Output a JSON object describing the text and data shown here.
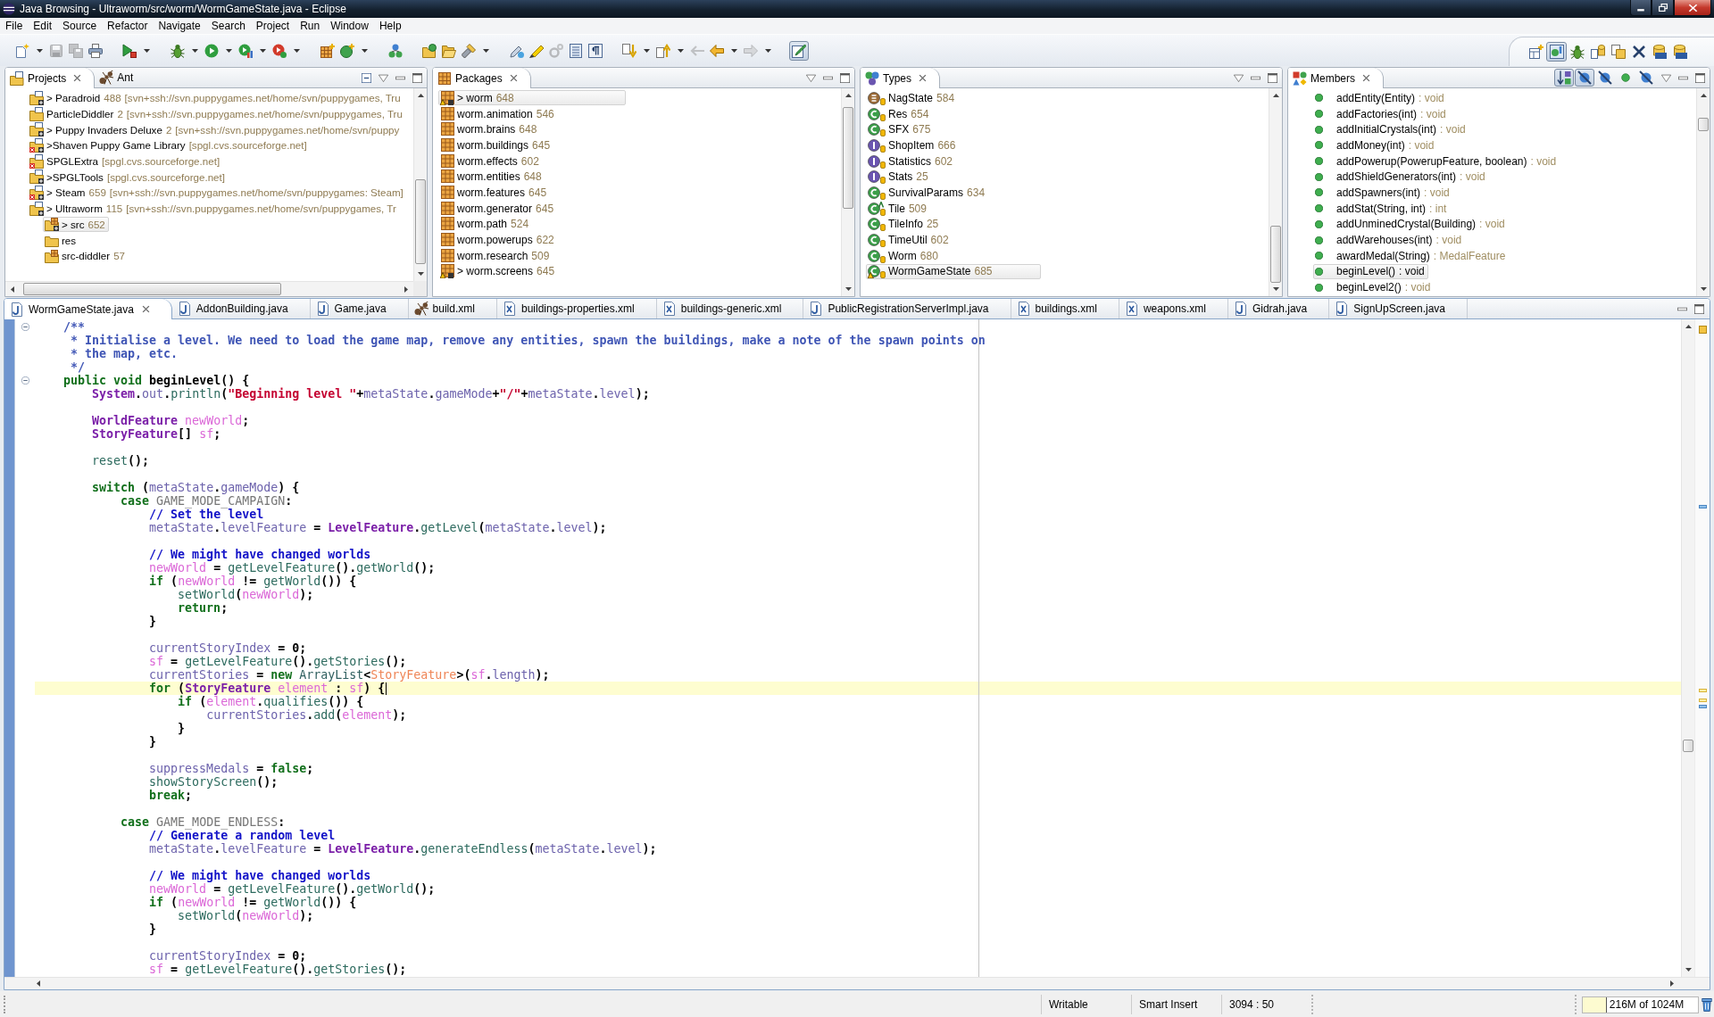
{
  "window": {
    "title": "Java Browsing - Ultraworm/src/worm/WormGameState.java - Eclipse"
  },
  "menu": [
    "File",
    "Edit",
    "Source",
    "Refactor",
    "Navigate",
    "Search",
    "Project",
    "Run",
    "Window",
    "Help"
  ],
  "toolbar": [
    {
      "items": [
        {
          "kind": "new",
          "dropdown": true,
          "disabled": false,
          "pressed": false
        },
        {
          "kind": "save",
          "dropdown": false,
          "disabled": true,
          "pressed": false
        },
        {
          "kind": "save_all",
          "dropdown": false,
          "disabled": true,
          "pressed": false
        },
        {
          "kind": "print",
          "dropdown": false,
          "disabled": false,
          "pressed": false
        }
      ]
    },
    {
      "items": [
        {
          "kind": "external",
          "dropdown": true,
          "disabled": false,
          "pressed": false
        }
      ]
    },
    {
      "items": [
        {
          "kind": "debug",
          "dropdown": true,
          "disabled": false,
          "pressed": false
        },
        {
          "kind": "run",
          "dropdown": true,
          "disabled": false,
          "pressed": false
        },
        {
          "kind": "coverage",
          "dropdown": true,
          "disabled": false,
          "pressed": false
        },
        {
          "kind": "tools",
          "dropdown": true,
          "disabled": false,
          "pressed": false
        }
      ]
    },
    {
      "items": [
        {
          "kind": "new_package",
          "dropdown": false,
          "disabled": false,
          "pressed": false
        },
        {
          "kind": "new_class",
          "dropdown": true,
          "disabled": false,
          "pressed": false
        }
      ]
    },
    {
      "items": [
        {
          "kind": "hierarchy",
          "dropdown": false,
          "disabled": false,
          "pressed": false
        }
      ]
    },
    {
      "items": [
        {
          "kind": "open_type",
          "dropdown": false,
          "disabled": false,
          "pressed": false
        },
        {
          "kind": "open_folder",
          "dropdown": false,
          "disabled": false,
          "pressed": false
        },
        {
          "kind": "search",
          "dropdown": true,
          "disabled": false,
          "pressed": false
        }
      ]
    },
    {
      "items": [
        {
          "kind": "mark",
          "dropdown": false,
          "disabled": false,
          "pressed": false
        },
        {
          "kind": "highlight",
          "dropdown": false,
          "disabled": false,
          "pressed": false
        },
        {
          "kind": "gears",
          "dropdown": false,
          "disabled": true,
          "pressed": false
        },
        {
          "kind": "block",
          "dropdown": false,
          "disabled": false,
          "pressed": false
        },
        {
          "kind": "whitespace",
          "dropdown": false,
          "disabled": false,
          "pressed": false
        }
      ]
    },
    {
      "items": [
        {
          "kind": "next",
          "dropdown": true,
          "disabled": false,
          "pressed": false
        },
        {
          "kind": "previous",
          "dropdown": true,
          "disabled": false,
          "pressed": false
        },
        {
          "kind": "last_edit",
          "dropdown": false,
          "disabled": true,
          "pressed": false
        },
        {
          "kind": "back",
          "dropdown": true,
          "disabled": false,
          "pressed": false
        },
        {
          "kind": "forward",
          "dropdown": true,
          "disabled": true,
          "pressed": false
        }
      ]
    },
    {
      "items": [
        {
          "kind": "breadcrumb",
          "dropdown": false,
          "disabled": false,
          "pressed": true
        }
      ]
    }
  ],
  "perspectives": [
    {
      "kind": "open",
      "selected": false
    },
    {
      "kind": "browsing",
      "selected": true
    },
    {
      "kind": "debug",
      "selected": false
    },
    {
      "kind": "sync",
      "selected": false
    },
    {
      "kind": "java",
      "selected": false
    },
    {
      "kind": "xml",
      "selected": false
    },
    {
      "kind": "svn",
      "selected": false
    },
    {
      "kind": "cvs",
      "selected": false
    }
  ],
  "projects_view": {
    "tabs": [
      {
        "kind": "projects",
        "label": "Projects",
        "selected": true
      },
      {
        "kind": "ant",
        "label": "Ant",
        "selected": false
      }
    ],
    "rows": [
      {
        "kind": "project",
        "label": "> Paradroid",
        "revision": "488",
        "repository": "[svn+ssh://svn.puppygames.net/home/svn/puppygames, Tru",
        "changed": true,
        "errors": false,
        "selected": false
      },
      {
        "kind": "project",
        "label": "ParticleDiddler",
        "revision": "2",
        "repository": "[svn+ssh://svn.puppygames.net/home/svn/puppygames, Tru",
        "changed": false,
        "errors": false,
        "selected": false
      },
      {
        "kind": "project",
        "label": "> Puppy Invaders Deluxe",
        "revision": "2",
        "repository": "[svn+ssh://svn.puppygames.net/home/svn/puppy",
        "changed": true,
        "errors": false,
        "selected": false
      },
      {
        "kind": "project",
        "label": ">Shaven Puppy Game Library",
        "repository": "[spgl.cvs.sourceforge.net]",
        "changed": true,
        "errors": true,
        "selected": false
      },
      {
        "kind": "project",
        "label": "SPGLExtra",
        "repository": "[spgl.cvs.sourceforge.net]",
        "changed": false,
        "errors": true,
        "selected": false
      },
      {
        "kind": "project",
        "label": ">SPGLTools",
        "repository": "[spgl.cvs.sourceforge.net]",
        "changed": true,
        "errors": false,
        "selected": false
      },
      {
        "kind": "project",
        "label": "> Steam",
        "revision": "659",
        "repository": "[svn+ssh://svn.puppygames.net/home/svn/puppygames: Steam]",
        "changed": true,
        "errors": true,
        "selected": false
      },
      {
        "kind": "project",
        "label": "> Ultraworm",
        "revision": "115",
        "repository": "[svn+ssh://svn.puppygames.net/home/svn/puppygames, Tr",
        "changed": true,
        "errors": false,
        "selected": false,
        "children": [
          {
            "kind": "source",
            "label": "> src",
            "revision": "652",
            "changed": true,
            "errors": false,
            "selected": true
          },
          {
            "kind": "folder",
            "label": "res",
            "changed": false,
            "errors": false,
            "selected": false
          },
          {
            "kind": "source",
            "label": "src-diddler",
            "revision": "57",
            "changed": false,
            "errors": false,
            "selected": false
          }
        ]
      }
    ]
  },
  "packages_view": {
    "tabs": [
      {
        "kind": "packages",
        "label": "Packages",
        "selected": true
      }
    ],
    "rows": [
      {
        "label": "> worm",
        "count": "648",
        "changed": true,
        "selected": true
      },
      {
        "label": "worm.animation",
        "count": "546",
        "changed": false,
        "selected": false
      },
      {
        "label": "worm.brains",
        "count": "648",
        "changed": false,
        "selected": false
      },
      {
        "label": "worm.buildings",
        "count": "645",
        "changed": false,
        "selected": false
      },
      {
        "label": "worm.effects",
        "count": "602",
        "changed": false,
        "selected": false
      },
      {
        "label": "worm.entities",
        "count": "648",
        "changed": false,
        "selected": false
      },
      {
        "label": "worm.features",
        "count": "645",
        "changed": false,
        "selected": false
      },
      {
        "label": "worm.generator",
        "count": "645",
        "changed": false,
        "selected": false
      },
      {
        "label": "worm.path",
        "count": "524",
        "changed": false,
        "selected": false
      },
      {
        "label": "worm.powerups",
        "count": "622",
        "changed": false,
        "selected": false
      },
      {
        "label": "worm.research",
        "count": "509",
        "changed": false,
        "selected": false
      },
      {
        "label": "> worm.screens",
        "count": "645",
        "changed": true,
        "selected": false
      }
    ]
  },
  "types_view": {
    "tabs": [
      {
        "kind": "types",
        "label": "Types",
        "selected": true
      }
    ],
    "rows": [
      {
        "kind": "enum",
        "label": "NagState",
        "count": "584",
        "abstract": false,
        "changed": false,
        "selected": false
      },
      {
        "kind": "class",
        "label": "Res",
        "count": "654",
        "abstract": false,
        "changed": false,
        "selected": false
      },
      {
        "kind": "class",
        "label": "SFX",
        "count": "675",
        "abstract": false,
        "changed": false,
        "selected": false
      },
      {
        "kind": "interface",
        "label": "ShopItem",
        "count": "666",
        "abstract": false,
        "changed": false,
        "selected": false
      },
      {
        "kind": "interface",
        "label": "Statistics",
        "count": "602",
        "abstract": false,
        "changed": false,
        "selected": false
      },
      {
        "kind": "interface",
        "label": "Stats",
        "count": "25",
        "abstract": false,
        "changed": false,
        "selected": false
      },
      {
        "kind": "class",
        "label": "SurvivalParams",
        "count": "634",
        "abstract": false,
        "changed": false,
        "selected": false
      },
      {
        "kind": "class",
        "label": "Tile",
        "count": "509",
        "abstract": true,
        "changed": false,
        "selected": false
      },
      {
        "kind": "class",
        "label": "TileInfo",
        "count": "25",
        "abstract": false,
        "changed": false,
        "selected": false
      },
      {
        "kind": "class",
        "label": "TimeUtil",
        "count": "602",
        "abstract": false,
        "changed": false,
        "selected": false
      },
      {
        "kind": "class",
        "label": "Worm",
        "count": "680",
        "abstract": false,
        "changed": false,
        "selected": false
      },
      {
        "kind": "class",
        "label": "WormGameState",
        "count": "685",
        "abstract": false,
        "changed": true,
        "selected": true
      }
    ]
  },
  "members_view": {
    "tabs": [
      {
        "kind": "members",
        "label": "Members",
        "selected": true
      }
    ],
    "toolbar": [
      {
        "kind": "sort",
        "pressed": true
      },
      {
        "kind": "fields",
        "pressed": true
      },
      {
        "kind": "static",
        "pressed": false
      },
      {
        "kind": "public",
        "pressed": false
      },
      {
        "kind": "local",
        "pressed": false
      }
    ],
    "rows": [
      {
        "signature": "addEntity(Entity)",
        "return_type": ": void",
        "selected": false
      },
      {
        "signature": "addFactories(int)",
        "return_type": ": void",
        "selected": false
      },
      {
        "signature": "addInitialCrystals(int)",
        "return_type": ": void",
        "selected": false
      },
      {
        "signature": "addMoney(int)",
        "return_type": ": void",
        "selected": false
      },
      {
        "signature": "addPowerup(PowerupFeature, boolean)",
        "return_type": ": void",
        "selected": false
      },
      {
        "signature": "addShieldGenerators(int)",
        "return_type": ": void",
        "selected": false
      },
      {
        "signature": "addSpawners(int)",
        "return_type": ": void",
        "selected": false
      },
      {
        "signature": "addStat(String, int)",
        "return_type": ": int",
        "selected": false
      },
      {
        "signature": "addUnminedCrystal(Building)",
        "return_type": ": void",
        "selected": false
      },
      {
        "signature": "addWarehouses(int)",
        "return_type": ": void",
        "selected": false
      },
      {
        "signature": "awardMedal(String)",
        "return_type": ": MedalFeature",
        "selected": false
      },
      {
        "signature": "beginLevel()",
        "return_type": ": void",
        "selected": true
      },
      {
        "signature": "beginLevel2()",
        "return_type": ": void",
        "selected": false
      }
    ]
  },
  "editor": {
    "tabs": [
      {
        "kind": "java",
        "label": "WormGameState.java",
        "selected": true
      },
      {
        "kind": "java",
        "label": "AddonBuilding.java",
        "selected": false
      },
      {
        "kind": "java",
        "label": "Game.java",
        "selected": false
      },
      {
        "kind": "ant",
        "label": "build.xml",
        "selected": false
      },
      {
        "kind": "xml",
        "label": "buildings-properties.xml",
        "selected": false
      },
      {
        "kind": "xml",
        "label": "buildings-generic.xml",
        "selected": false
      },
      {
        "kind": "java",
        "label": "PublicRegistrationServerImpl.java",
        "selected": false
      },
      {
        "kind": "xml",
        "label": "buildings.xml",
        "selected": false
      },
      {
        "kind": "xml",
        "label": "weapons.xml",
        "selected": false
      },
      {
        "kind": "java",
        "label": "Gidrah.java",
        "selected": false
      },
      {
        "kind": "java",
        "label": "SignUpScreen.java",
        "selected": false
      }
    ],
    "lines": [
      {
        "current": false,
        "fold": true,
        "tokens": [
          {
            "kind": "jdoc",
            "text": "    /**"
          }
        ]
      },
      {
        "current": false,
        "fold": false,
        "tokens": [
          {
            "kind": "jdoc",
            "text": "     * Initialise a level. We need to load the game map, remove any entities, spawn the buildings, make a note of the spawn points on"
          }
        ]
      },
      {
        "current": false,
        "fold": false,
        "tokens": [
          {
            "kind": "jdoc",
            "text": "     * the map, etc."
          }
        ]
      },
      {
        "current": false,
        "fold": false,
        "tokens": [
          {
            "kind": "jdoc",
            "text": "     */"
          }
        ]
      },
      {
        "current": false,
        "fold": true,
        "tokens": [
          {
            "kind": "kw",
            "text": "    public void "
          },
          {
            "kind": "decl",
            "text": "beginLevel"
          },
          {
            "kind": "op",
            "text": "() {"
          }
        ]
      },
      {
        "current": false,
        "fold": false,
        "tokens": [
          {
            "kind": "type",
            "text": "        System"
          },
          {
            "kind": "op",
            "text": "."
          },
          {
            "kind": "field",
            "text": "out"
          },
          {
            "kind": "op",
            "text": "."
          },
          {
            "kind": "method",
            "text": "println"
          },
          {
            "kind": "op",
            "text": "("
          },
          {
            "kind": "str",
            "text": "\"Beginning level \""
          },
          {
            "kind": "op",
            "text": "+"
          },
          {
            "kind": "field",
            "text": "metaState"
          },
          {
            "kind": "op",
            "text": "."
          },
          {
            "kind": "field",
            "text": "gameMode"
          },
          {
            "kind": "op",
            "text": "+"
          },
          {
            "kind": "str",
            "text": "\"/\""
          },
          {
            "kind": "op",
            "text": "+"
          },
          {
            "kind": "field",
            "text": "metaState"
          },
          {
            "kind": "op",
            "text": "."
          },
          {
            "kind": "field",
            "text": "level"
          },
          {
            "kind": "op",
            "text": ");"
          }
        ]
      },
      {
        "current": false,
        "fold": false
      },
      {
        "current": false,
        "fold": false,
        "tokens": [
          {
            "kind": "type",
            "text": "        WorldFeature "
          },
          {
            "kind": "local",
            "text": "newWorld"
          },
          {
            "kind": "op",
            "text": ";"
          }
        ]
      },
      {
        "current": false,
        "fold": false,
        "tokens": [
          {
            "kind": "type",
            "text": "        StoryFeature"
          },
          {
            "kind": "op",
            "text": "[] "
          },
          {
            "kind": "local",
            "text": "sf"
          },
          {
            "kind": "op",
            "text": ";"
          }
        ]
      },
      {
        "current": false,
        "fold": false
      },
      {
        "current": false,
        "fold": false,
        "tokens": [
          {
            "kind": "method",
            "text": "        reset"
          },
          {
            "kind": "op",
            "text": "();"
          }
        ]
      },
      {
        "current": false,
        "fold": false
      },
      {
        "current": false,
        "fold": false,
        "tokens": [
          {
            "kind": "kw",
            "text": "        switch "
          },
          {
            "kind": "op",
            "text": "("
          },
          {
            "kind": "field",
            "text": "metaState"
          },
          {
            "kind": "op",
            "text": "."
          },
          {
            "kind": "field",
            "text": "gameMode"
          },
          {
            "kind": "op",
            "text": ") {"
          }
        ]
      },
      {
        "current": false,
        "fold": false,
        "tokens": [
          {
            "kind": "kw",
            "text": "            case "
          },
          {
            "kind": "static",
            "text": "GAME_MODE_CAMPAIGN"
          },
          {
            "kind": "op",
            "text": ":"
          }
        ]
      },
      {
        "current": false,
        "fold": false,
        "tokens": [
          {
            "kind": "cmt",
            "text": "                // Set the level"
          }
        ]
      },
      {
        "current": false,
        "fold": false,
        "tokens": [
          {
            "kind": "field",
            "text": "                metaState"
          },
          {
            "kind": "op",
            "text": "."
          },
          {
            "kind": "field",
            "text": "levelFeature"
          },
          {
            "kind": "op",
            "text": " = "
          },
          {
            "kind": "type",
            "text": "LevelFeature"
          },
          {
            "kind": "op",
            "text": "."
          },
          {
            "kind": "method",
            "text": "getLevel"
          },
          {
            "kind": "op",
            "text": "("
          },
          {
            "kind": "field",
            "text": "metaState"
          },
          {
            "kind": "op",
            "text": "."
          },
          {
            "kind": "field",
            "text": "level"
          },
          {
            "kind": "op",
            "text": ");"
          }
        ]
      },
      {
        "current": false,
        "fold": false
      },
      {
        "current": false,
        "fold": false,
        "tokens": [
          {
            "kind": "cmt",
            "text": "                // We might have changed worlds"
          }
        ]
      },
      {
        "current": false,
        "fold": false,
        "tokens": [
          {
            "kind": "local",
            "text": "                newWorld"
          },
          {
            "kind": "op",
            "text": " = "
          },
          {
            "kind": "method",
            "text": "getLevelFeature"
          },
          {
            "kind": "op",
            "text": "()."
          },
          {
            "kind": "method",
            "text": "getWorld"
          },
          {
            "kind": "op",
            "text": "();"
          }
        ]
      },
      {
        "current": false,
        "fold": false,
        "tokens": [
          {
            "kind": "kw",
            "text": "                if "
          },
          {
            "kind": "op",
            "text": "("
          },
          {
            "kind": "local",
            "text": "newWorld"
          },
          {
            "kind": "op",
            "text": " != "
          },
          {
            "kind": "method",
            "text": "getWorld"
          },
          {
            "kind": "op",
            "text": "()) {"
          }
        ]
      },
      {
        "current": false,
        "fold": false,
        "tokens": [
          {
            "kind": "method",
            "text": "                    setWorld"
          },
          {
            "kind": "op",
            "text": "("
          },
          {
            "kind": "local",
            "text": "newWorld"
          },
          {
            "kind": "op",
            "text": ");"
          }
        ]
      },
      {
        "current": false,
        "fold": false,
        "tokens": [
          {
            "kind": "kw",
            "text": "                    return"
          },
          {
            "kind": "op",
            "text": ";"
          }
        ]
      },
      {
        "current": false,
        "fold": false,
        "tokens": [
          {
            "kind": "op",
            "text": "                }"
          }
        ]
      },
      {
        "current": false,
        "fold": false
      },
      {
        "current": false,
        "fold": false,
        "tokens": [
          {
            "kind": "field",
            "text": "                currentStoryIndex"
          },
          {
            "kind": "op",
            "text": " = "
          },
          {
            "kind": "num",
            "text": "0"
          },
          {
            "kind": "op",
            "text": ";"
          }
        ]
      },
      {
        "current": false,
        "fold": false,
        "tokens": [
          {
            "kind": "local",
            "text": "                sf"
          },
          {
            "kind": "op",
            "text": " = "
          },
          {
            "kind": "method",
            "text": "getLevelFeature"
          },
          {
            "kind": "op",
            "text": "()."
          },
          {
            "kind": "method",
            "text": "getStories"
          },
          {
            "kind": "op",
            "text": "();"
          }
        ]
      },
      {
        "current": false,
        "fold": false,
        "tokens": [
          {
            "kind": "field",
            "text": "                currentStories"
          },
          {
            "kind": "op",
            "text": " = "
          },
          {
            "kind": "kw",
            "text": "new "
          },
          {
            "kind": "generic",
            "text": "ArrayList"
          },
          {
            "kind": "op",
            "text": "<"
          },
          {
            "kind": "typearg",
            "text": "StoryFeature"
          },
          {
            "kind": "op",
            "text": ">("
          },
          {
            "kind": "local",
            "text": "sf"
          },
          {
            "kind": "op",
            "text": "."
          },
          {
            "kind": "field",
            "text": "length"
          },
          {
            "kind": "op",
            "text": ");"
          }
        ]
      },
      {
        "current": true,
        "fold": false,
        "tokens": [
          {
            "kind": "kw",
            "text": "                for "
          },
          {
            "kind": "op",
            "text": "("
          },
          {
            "kind": "type",
            "text": "StoryFeature "
          },
          {
            "kind": "local",
            "text": "element"
          },
          {
            "kind": "op",
            "text": " : "
          },
          {
            "kind": "local",
            "text": "sf"
          },
          {
            "kind": "op",
            "text": ") {"
          }
        ]
      },
      {
        "current": false,
        "fold": false,
        "tokens": [
          {
            "kind": "kw",
            "text": "                    if "
          },
          {
            "kind": "op",
            "text": "("
          },
          {
            "kind": "local",
            "text": "element"
          },
          {
            "kind": "op",
            "text": "."
          },
          {
            "kind": "method",
            "text": "qualifies"
          },
          {
            "kind": "op",
            "text": "()) {"
          }
        ]
      },
      {
        "current": false,
        "fold": false,
        "tokens": [
          {
            "kind": "field",
            "text": "                        currentStories"
          },
          {
            "kind": "op",
            "text": "."
          },
          {
            "kind": "method",
            "text": "add"
          },
          {
            "kind": "op",
            "text": "("
          },
          {
            "kind": "local",
            "text": "element"
          },
          {
            "kind": "op",
            "text": ");"
          }
        ]
      },
      {
        "current": false,
        "fold": false,
        "tokens": [
          {
            "kind": "op",
            "text": "                    }"
          }
        ]
      },
      {
        "current": false,
        "fold": false,
        "tokens": [
          {
            "kind": "op",
            "text": "                }"
          }
        ]
      },
      {
        "current": false,
        "fold": false
      },
      {
        "current": false,
        "fold": false,
        "tokens": [
          {
            "kind": "field",
            "text": "                suppressMedals"
          },
          {
            "kind": "op",
            "text": " = "
          },
          {
            "kind": "kw",
            "text": "false"
          },
          {
            "kind": "op",
            "text": ";"
          }
        ]
      },
      {
        "current": false,
        "fold": false,
        "tokens": [
          {
            "kind": "method",
            "text": "                showStoryScreen"
          },
          {
            "kind": "op",
            "text": "();"
          }
        ]
      },
      {
        "current": false,
        "fold": false,
        "tokens": [
          {
            "kind": "kw",
            "text": "                break"
          },
          {
            "kind": "op",
            "text": ";"
          }
        ]
      },
      {
        "current": false,
        "fold": false
      },
      {
        "current": false,
        "fold": false,
        "tokens": [
          {
            "kind": "kw",
            "text": "            case "
          },
          {
            "kind": "static",
            "text": "GAME_MODE_ENDLESS"
          },
          {
            "kind": "op",
            "text": ":"
          }
        ]
      },
      {
        "current": false,
        "fold": false,
        "tokens": [
          {
            "kind": "cmt",
            "text": "                // Generate a random level"
          }
        ]
      },
      {
        "current": false,
        "fold": false,
        "tokens": [
          {
            "kind": "field",
            "text": "                metaState"
          },
          {
            "kind": "op",
            "text": "."
          },
          {
            "kind": "field",
            "text": "levelFeature"
          },
          {
            "kind": "op",
            "text": " = "
          },
          {
            "kind": "type",
            "text": "LevelFeature"
          },
          {
            "kind": "op",
            "text": "."
          },
          {
            "kind": "method",
            "text": "generateEndless"
          },
          {
            "kind": "op",
            "text": "("
          },
          {
            "kind": "field",
            "text": "metaState"
          },
          {
            "kind": "op",
            "text": "."
          },
          {
            "kind": "field",
            "text": "level"
          },
          {
            "kind": "op",
            "text": ");"
          }
        ]
      },
      {
        "current": false,
        "fold": false
      },
      {
        "current": false,
        "fold": false,
        "tokens": [
          {
            "kind": "cmt",
            "text": "                // We might have changed worlds"
          }
        ]
      },
      {
        "current": false,
        "fold": false,
        "tokens": [
          {
            "kind": "local",
            "text": "                newWorld"
          },
          {
            "kind": "op",
            "text": " = "
          },
          {
            "kind": "method",
            "text": "getLevelFeature"
          },
          {
            "kind": "op",
            "text": "()."
          },
          {
            "kind": "method",
            "text": "getWorld"
          },
          {
            "kind": "op",
            "text": "();"
          }
        ]
      },
      {
        "current": false,
        "fold": false,
        "tokens": [
          {
            "kind": "kw",
            "text": "                if "
          },
          {
            "kind": "op",
            "text": "("
          },
          {
            "kind": "local",
            "text": "newWorld"
          },
          {
            "kind": "op",
            "text": " != "
          },
          {
            "kind": "method",
            "text": "getWorld"
          },
          {
            "kind": "op",
            "text": "()) {"
          }
        ]
      },
      {
        "current": false,
        "fold": false,
        "tokens": [
          {
            "kind": "method",
            "text": "                    setWorld"
          },
          {
            "kind": "op",
            "text": "("
          },
          {
            "kind": "local",
            "text": "newWorld"
          },
          {
            "kind": "op",
            "text": ");"
          }
        ]
      },
      {
        "current": false,
        "fold": false,
        "tokens": [
          {
            "kind": "op",
            "text": "                }"
          }
        ]
      },
      {
        "current": false,
        "fold": false
      },
      {
        "current": false,
        "fold": false,
        "tokens": [
          {
            "kind": "field",
            "text": "                currentStoryIndex"
          },
          {
            "kind": "op",
            "text": " = "
          },
          {
            "kind": "num",
            "text": "0"
          },
          {
            "kind": "op",
            "text": ";"
          }
        ]
      },
      {
        "current": false,
        "fold": false,
        "tokens": [
          {
            "kind": "local",
            "text": "                sf"
          },
          {
            "kind": "op",
            "text": " = "
          },
          {
            "kind": "method",
            "text": "getLevelFeature"
          },
          {
            "kind": "op",
            "text": "()."
          },
          {
            "kind": "method",
            "text": "getStories"
          },
          {
            "kind": "op",
            "text": "();"
          }
        ]
      }
    ]
  },
  "status_bar": {
    "fields": [
      "Writable",
      "Smart Insert",
      "3094 : 50"
    ],
    "heap": {
      "text": "216M of 1024M",
      "level": 0.21
    }
  }
}
